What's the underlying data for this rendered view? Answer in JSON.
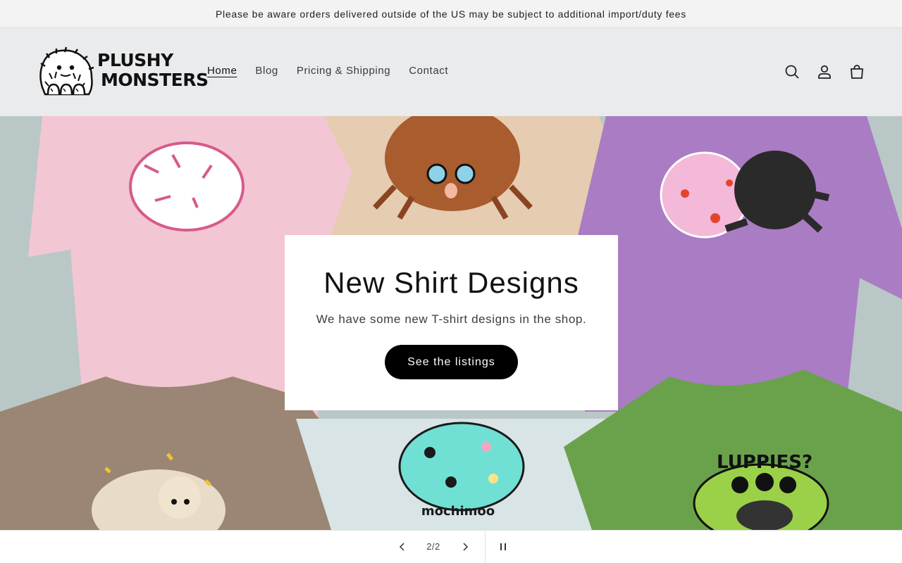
{
  "announcement": {
    "text": "Please be aware orders delivered outside of the US may be subject to additional import/duty fees"
  },
  "header": {
    "logo": {
      "line1": "PLUSHY",
      "line2": "MONSTERS"
    },
    "nav": [
      {
        "label": "Home",
        "active": true
      },
      {
        "label": "Blog",
        "active": false
      },
      {
        "label": "Pricing & Shipping",
        "active": false
      },
      {
        "label": "Contact",
        "active": false
      }
    ],
    "icons": [
      "search-icon",
      "account-icon",
      "cart-icon"
    ]
  },
  "hero": {
    "title": "New Shirt Designs",
    "subtitle": "We have some new T-shirt designs in the shop.",
    "button_label": "See the listings",
    "shirt_colors": [
      "#f2c6d2",
      "#e6ccb0",
      "#a97cc4",
      "#9b8574",
      "#d8e4e6",
      "#6aa24b"
    ],
    "shirt_print_text": [
      "LUPPIES?",
      "mochimoo"
    ]
  },
  "slider": {
    "counter": "2/2",
    "prev_icon": "chevron-left-icon",
    "next_icon": "chevron-right-icon",
    "pause_icon": "pause-icon"
  }
}
